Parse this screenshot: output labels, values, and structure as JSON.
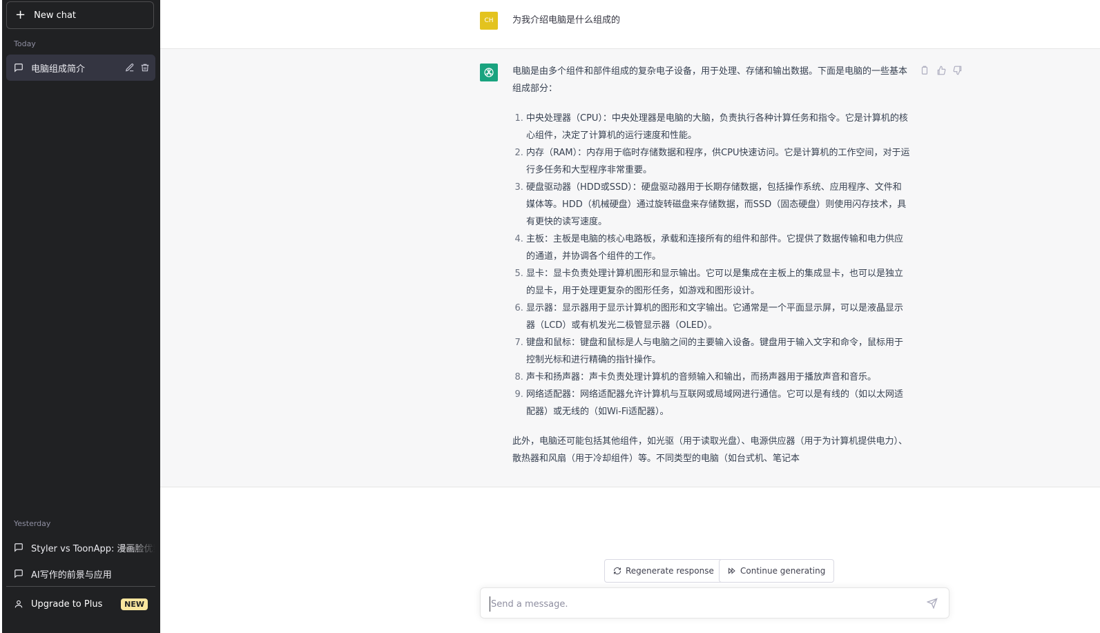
{
  "sidebar": {
    "new_chat": "New chat",
    "today_label": "Today",
    "today_items": [
      {
        "label": "电脑组成简介"
      }
    ],
    "yesterday_label": "Yesterday",
    "yesterday_items": [
      {
        "label": "Styler vs ToonApp: 漫画脸优势"
      },
      {
        "label": "AI写作的前景与应用"
      }
    ],
    "upgrade_label": "Upgrade to Plus",
    "upgrade_badge": "NEW"
  },
  "conversation": {
    "user_initials": "CH",
    "user_message": "为我介绍电脑是什么组成的",
    "assistant_intro": "电脑是由多个组件和部件组成的复杂电子设备，用于处理、存储和输出数据。下面是电脑的一些基本组成部分：",
    "assistant_items": [
      "中央处理器（CPU）：中央处理器是电脑的大脑，负责执行各种计算任务和指令。它是计算机的核心组件，决定了计算机的运行速度和性能。",
      "内存（RAM）：内存用于临时存储数据和程序，供CPU快速访问。它是计算机的工作空间，对于运行多任务和大型程序非常重要。",
      "硬盘驱动器（HDD或SSD）：硬盘驱动器用于长期存储数据，包括操作系统、应用程序、文件和媒体等。HDD（机械硬盘）通过旋转磁盘来存储数据，而SSD（固态硬盘）则使用闪存技术，具有更快的读写速度。",
      "主板：主板是电脑的核心电路板，承载和连接所有的组件和部件。它提供了数据传输和电力供应的通道，并协调各个组件的工作。",
      "显卡：显卡负责处理计算机图形和显示输出。它可以是集成在主板上的集成显卡，也可以是独立的显卡，用于处理更复杂的图形任务，如游戏和图形设计。",
      "显示器：显示器用于显示计算机的图形和文字输出。它通常是一个平面显示屏，可以是液晶显示器（LCD）或有机发光二极管显示器（OLED）。",
      "键盘和鼠标：键盘和鼠标是人与电脑之间的主要输入设备。键盘用于输入文字和命令，鼠标用于控制光标和进行精确的指针操作。",
      "声卡和扬声器：声卡负责处理计算机的音频输入和输出，而扬声器用于播放声音和音乐。",
      "网络适配器：网络适配器允许计算机与互联网或局域网进行通信。它可以是有线的（如以太网适配器）或无线的（如Wi-Fi适配器）。"
    ],
    "assistant_outro": "此外，电脑还可能包括其他组件，如光驱（用于读取光盘）、电源供应器（用于为计算机提供电力）、散热器和风扇（用于冷却组件）等。不同类型的电脑（如台式机、笔记本"
  },
  "actions": {
    "regenerate": "Regenerate response",
    "continue": "Continue generating"
  },
  "composer": {
    "placeholder": "Send a message."
  },
  "colors": {
    "sidebar_bg": "#202123",
    "assistant_bg": "#f7f7f8",
    "gpt_avatar": "#19a37f",
    "user_avatar": "#e3c31f",
    "badge": "#fae69e"
  }
}
